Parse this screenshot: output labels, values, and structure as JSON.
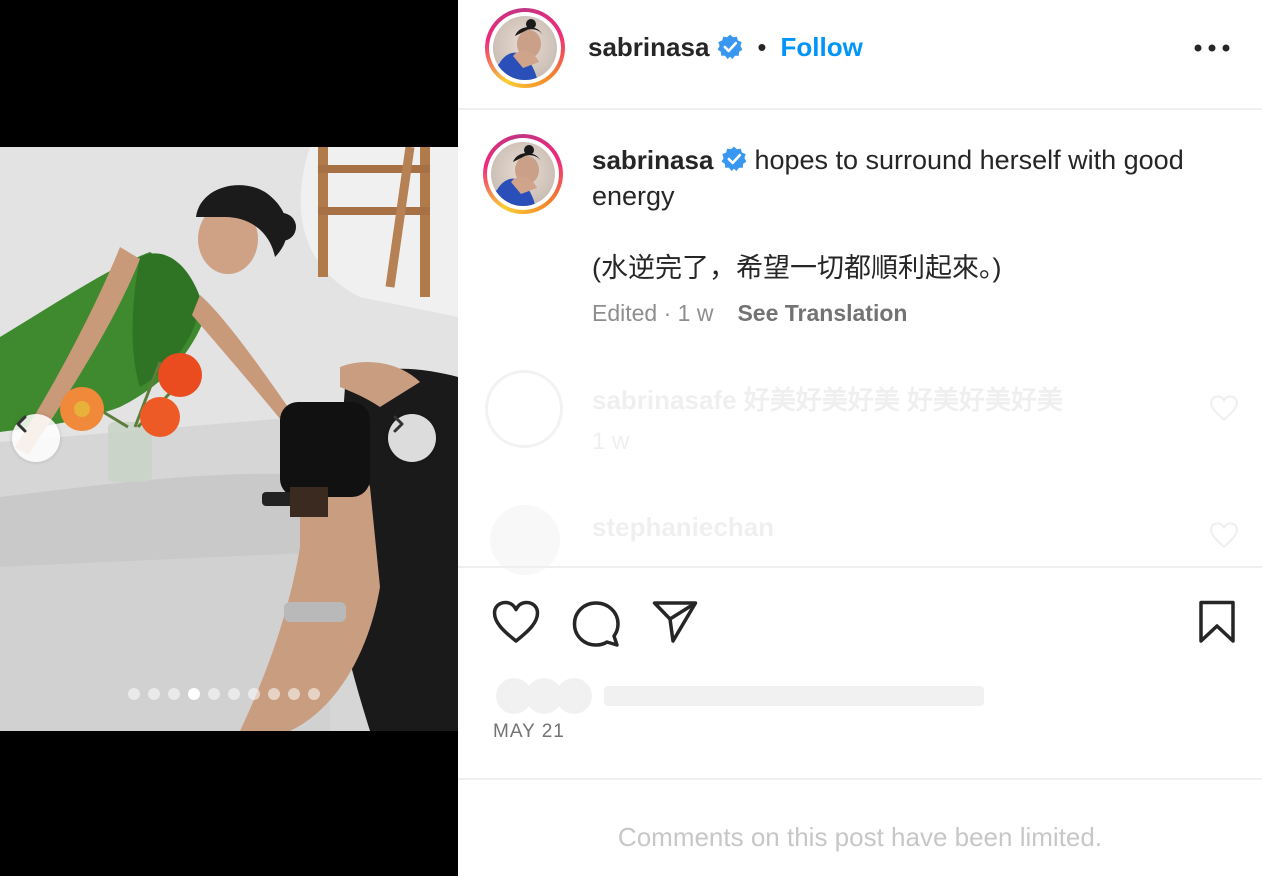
{
  "post": {
    "username": "sabrinasa",
    "separator": "•",
    "follow_label": "Follow",
    "caption_text": "hopes to surround herself with good energy",
    "caption_chinese": "(水逆完了，希望一切都順利起來。)",
    "edited_label": "Edited · 1 w",
    "see_translation_label": "See Translation",
    "date": "MAY 21",
    "comments_limited": "Comments on this post have been limited."
  },
  "faded_comments": [
    {
      "username": "sabrinasafe",
      "text": "好美好美好美 好美好美好美",
      "time": "1 w"
    },
    {
      "username": "stephaniechan",
      "text": ""
    }
  ],
  "carousel": {
    "total_slides": 10,
    "active_index": 3
  },
  "icons": {
    "verified": "verified-badge-icon",
    "more": "more-options-icon",
    "like": "heart-icon",
    "comment": "comment-bubble-icon",
    "share": "paper-plane-icon",
    "save": "bookmark-icon",
    "prev": "chevron-left-icon",
    "next": "chevron-right-icon"
  },
  "colors": {
    "follow_blue": "#0095f6",
    "verified_blue": "#3897f0",
    "text_primary": "#262626",
    "text_secondary": "#8e8e8e",
    "muted": "#c7c7c7"
  }
}
